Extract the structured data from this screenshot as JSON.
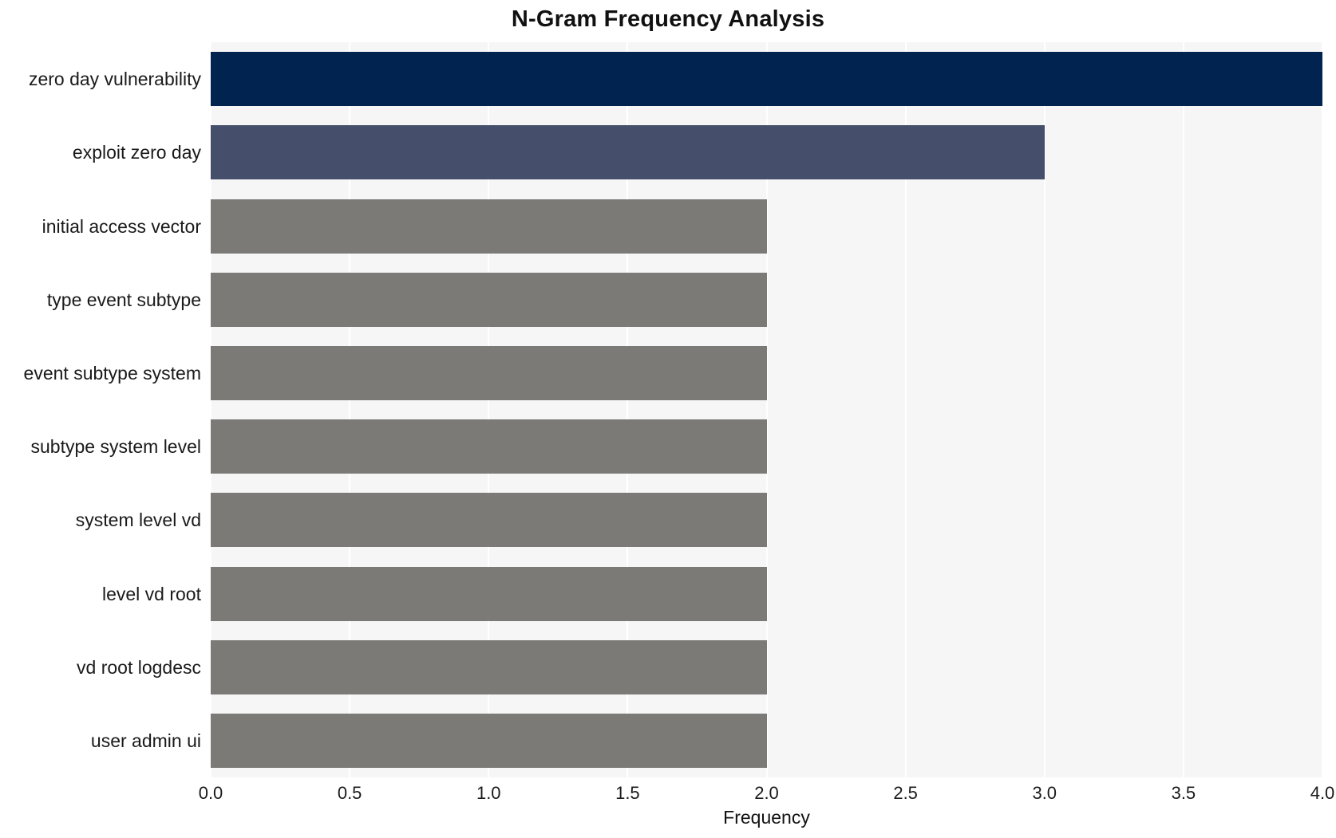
{
  "chart_data": {
    "type": "bar",
    "orientation": "horizontal",
    "title": "N-Gram Frequency Analysis",
    "xlabel": "Frequency",
    "ylabel": "",
    "xlim": [
      0.0,
      4.0
    ],
    "xticks": [
      "0.0",
      "0.5",
      "1.0",
      "1.5",
      "2.0",
      "2.5",
      "3.0",
      "3.5",
      "4.0"
    ],
    "xtick_values": [
      0.0,
      0.5,
      1.0,
      1.5,
      2.0,
      2.5,
      3.0,
      3.5,
      4.0
    ],
    "grid": true,
    "grid_axis": "x",
    "grid_color": "#ffffff",
    "plot_background": "#f6f6f6",
    "figure_background": "#ffffff",
    "legend": null,
    "categories": [
      "zero day vulnerability",
      "exploit zero day",
      "initial access vector",
      "type event subtype",
      "event subtype system",
      "subtype system level",
      "system level vd",
      "level vd root",
      "vd root logdesc",
      "user admin ui"
    ],
    "values": [
      4,
      3,
      2,
      2,
      2,
      2,
      2,
      2,
      2,
      2
    ],
    "bar_colors": [
      "#00234f",
      "#454f6b",
      "#7b7a77",
      "#7b7a77",
      "#7b7a77",
      "#7b7a77",
      "#7b7a77",
      "#7b7a77",
      "#7b7a77",
      "#7b7a77"
    ]
  }
}
